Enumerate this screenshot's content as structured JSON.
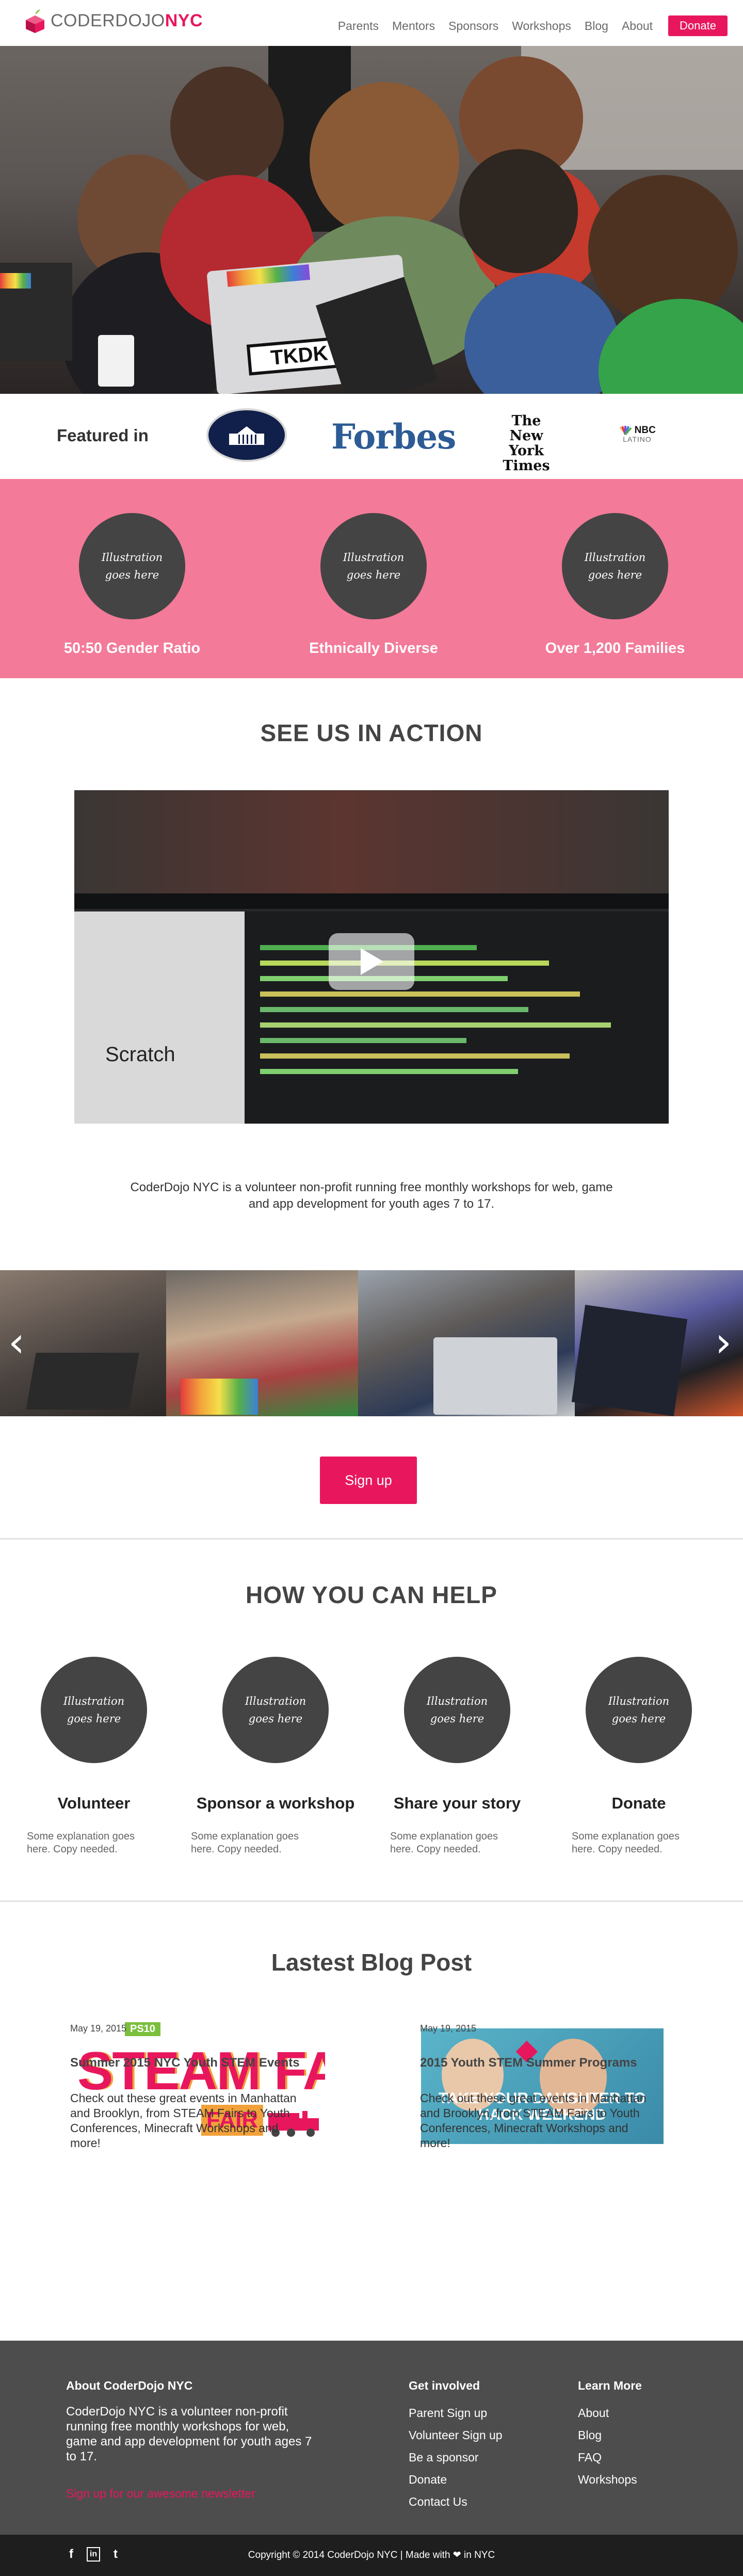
{
  "header": {
    "logo_main": "CODERDOJO",
    "logo_accent": "NYC",
    "nav": [
      "Parents",
      "Mentors",
      "Sponsors",
      "Workshops",
      "Blog",
      "About"
    ],
    "donate": "Donate"
  },
  "featured": {
    "label": "Featured in",
    "logos": [
      "white-house-logo",
      "forbes-logo",
      "new-york-times-logo",
      "nbc-latino-logo"
    ],
    "forbes_text": "Forbes",
    "nyt_text": [
      "The",
      "New York",
      "Times"
    ],
    "nbc_text": [
      "NBC",
      "LATINO"
    ]
  },
  "stats": [
    {
      "illustration": "Illustration goes here",
      "label": "50:50 Gender Ratio"
    },
    {
      "illustration": "Illustration goes here",
      "label": "Ethnically Diverse"
    },
    {
      "illustration": "Illustration goes here",
      "label": "Over 1,200 Families"
    }
  ],
  "action": {
    "title": "SEE US IN ACTION",
    "about": "CoderDojo NYC is a volunteer non-profit running free monthly workshops for web, game and app development for youth ages 7 to 17.",
    "signup": "Sign up"
  },
  "help": {
    "title": "HOW YOU CAN HELP",
    "items": [
      {
        "illustration": "Illustration goes here",
        "title": "Volunteer",
        "desc": "Some explanation goes here. Copy needed."
      },
      {
        "illustration": "Illustration goes here",
        "title": "Sponsor a workshop",
        "desc": "Some explanation goes here. Copy needed."
      },
      {
        "illustration": "Illustration goes here",
        "title": "Share your story",
        "desc": "Some explanation goes here. Copy needed."
      },
      {
        "illustration": "Illustration goes here",
        "title": "Donate",
        "desc": "Some explanation goes here. Copy needed."
      }
    ]
  },
  "blog": {
    "title": "Lastest Blog Post",
    "posts": [
      {
        "date": "May 19, 2015",
        "title": "Summer 2015 NYC Youth STEM Events",
        "excerpt": "Check out these great events in Manhattan and Brooklyn, from STEAM Fairs to Youth Conferences, Minecraft Workshops and more!",
        "image_text": "STEAM FAIR",
        "badge": "PS10"
      },
      {
        "date": "May 19, 2015",
        "title": "2015 Youth STEM Summer Programs",
        "excerpt": "Check out these great events in Manhattan and Brooklyn, from STEAM Fairs to Youth Conferences, Minecraft Workshops and more!",
        "image_text": "TAKE YOUR DAUGHTER TO HACK WEEKEND"
      }
    ]
  },
  "footer": {
    "about_title": "About CoderDojo NYC",
    "about_text": "CoderDojo NYC is a volunteer non-profit running free monthly workshops for web, game and app development for youth ages 7 to 17.",
    "newsletter": "Sign up for our awesome newsletter",
    "involved_title": "Get involved",
    "involved": [
      "Parent Sign up",
      "Volunteer Sign up",
      "Be a sponsor",
      "Donate",
      "Contact Us"
    ],
    "learn_title": "Learn More",
    "learn": [
      "About",
      "Blog",
      "FAQ",
      "Workshops"
    ],
    "copyright": "Copyright © 2014 CoderDojo NYC | Made with ❤ in NYC",
    "social": [
      "f",
      "in",
      "t"
    ]
  },
  "colors": {
    "brand": "#e8175d",
    "pink_band": "#f37a99",
    "footer": "#4d4d4d",
    "bottom_bar": "#1e1e1e"
  }
}
